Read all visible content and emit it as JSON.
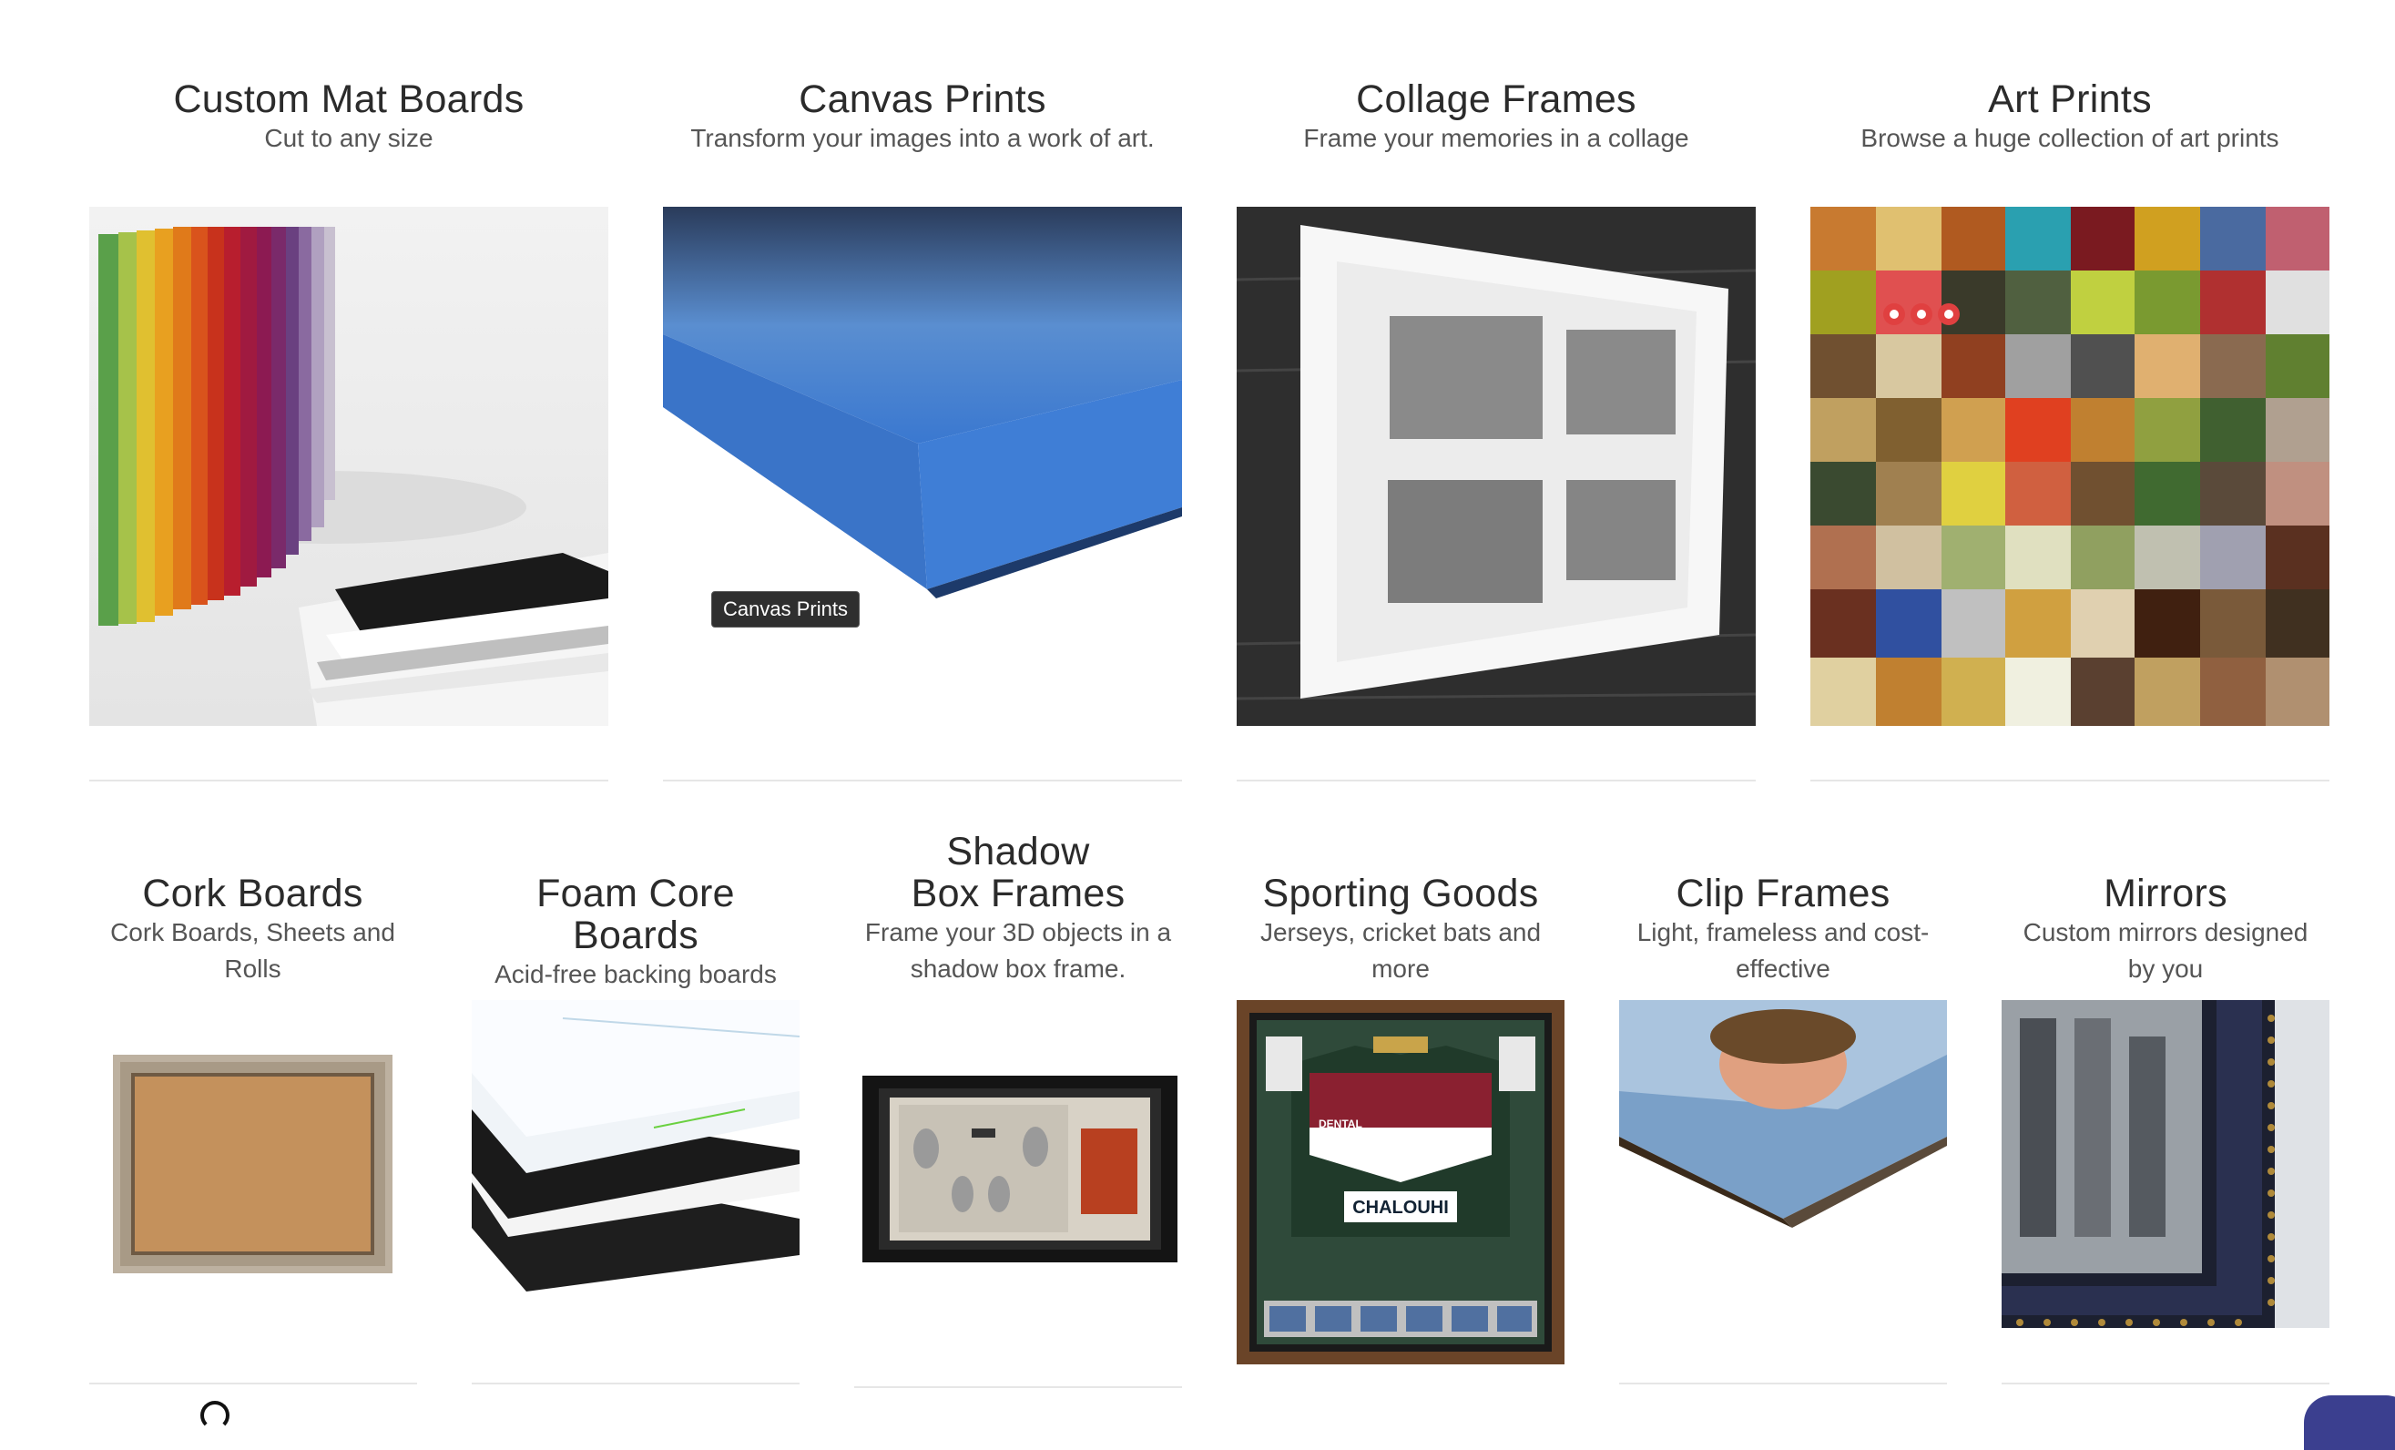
{
  "row1": [
    {
      "title": "Custom Mat Boards",
      "subtitle": "Cut to any size"
    },
    {
      "title": "Canvas Prints",
      "subtitle": "Transform your images into a work of art."
    },
    {
      "title": "Collage Frames",
      "subtitle": "Frame your memories in a collage"
    },
    {
      "title": "Art Prints",
      "subtitle": "Browse a huge collection of art prints"
    }
  ],
  "row2": [
    {
      "title": "Cork Boards",
      "subtitle": "Cork Boards, Sheets and Rolls"
    },
    {
      "title": "Foam Core Boards",
      "subtitle": "Acid-free backing boards"
    },
    {
      "title": "Shadow Box Frames",
      "subtitle": "Frame your 3D objects in a shadow box frame."
    },
    {
      "title": "Sporting Goods",
      "subtitle": "Jerseys, cricket bats and more"
    },
    {
      "title": "Clip Frames",
      "subtitle": "Light, frameless and cost-effective"
    },
    {
      "title": "Mirrors",
      "subtitle": "Custom mirrors designed by you"
    }
  ],
  "tooltip": {
    "text": "Canvas Prints"
  },
  "images": {
    "sporting_jersey_text": "CHALOUHI",
    "sporting_sponsor_text": "DENTAL"
  },
  "colors": {
    "chat_bubble": "#3b3f8f"
  }
}
